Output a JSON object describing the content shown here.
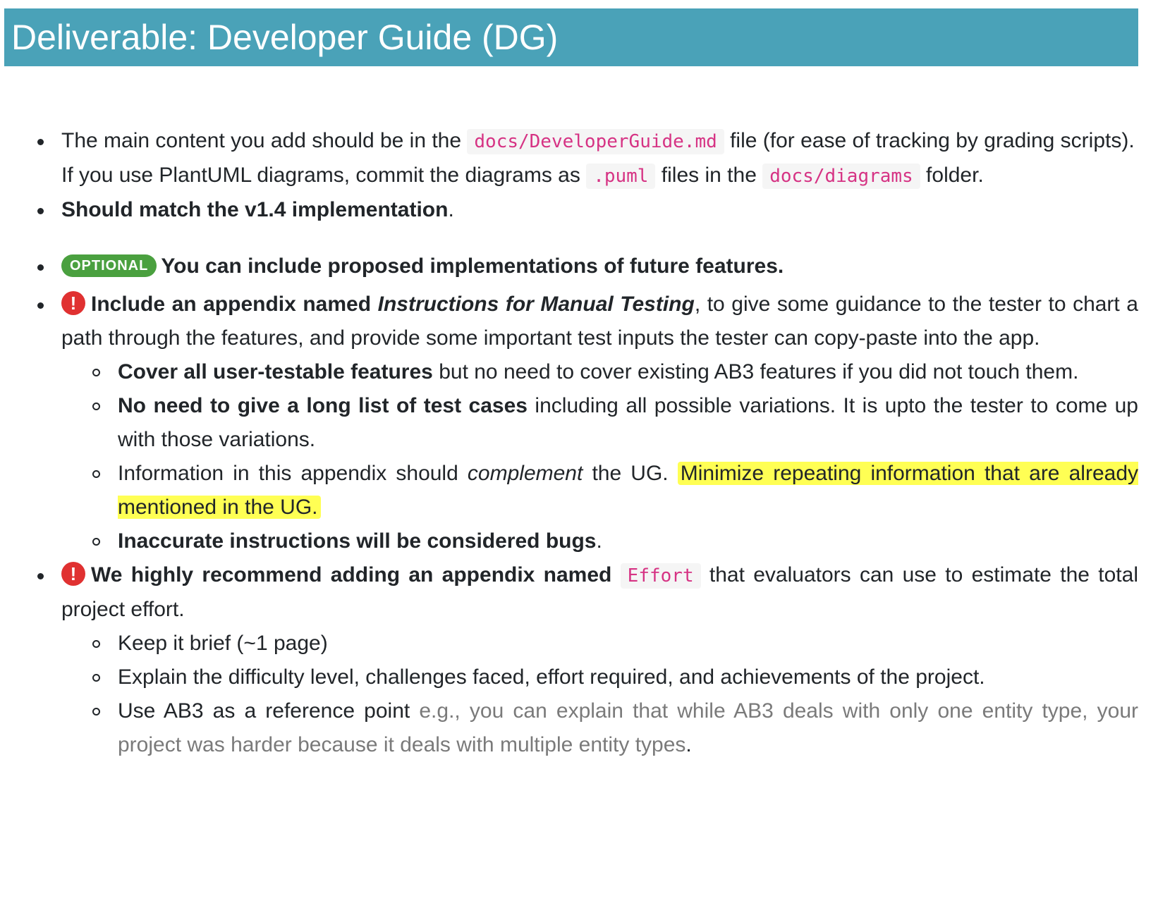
{
  "header": {
    "title": "Deliverable: Developer Guide (DG)"
  },
  "items": {
    "i1": {
      "t1": "The main content you add should be in the ",
      "code1": "docs/DeveloperGuide.md",
      "t2": " file (for ease of tracking by grading scripts).",
      "t3": "If you use PlantUML diagrams, commit the diagrams as ",
      "code2": ".puml",
      "t4": " files in the ",
      "code3": "docs/diagrams",
      "t5": " folder."
    },
    "i2": {
      "bold": "Should match the v1.4 implementation",
      "t": "."
    },
    "i3": {
      "badge": "OPTIONAL",
      "bold": "You can include proposed implementations of future features."
    },
    "i4": {
      "icon": "!",
      "bold1": "Include an appendix named ",
      "italic": "Instructions for Manual Testing",
      "t": ", to give some guidance to the tester to chart a path through the features, and provide some important test inputs the tester can copy-paste into the app.",
      "sub": {
        "s1": {
          "bold": "Cover all user-testable features",
          "t": " but no need to cover existing AB3 features if you did not touch them."
        },
        "s2": {
          "bold": "No need to give a long list of test cases",
          "t": " including all possible variations. It is upto the tester to come up with those variations."
        },
        "s3": {
          "t1": "Information in this appendix should ",
          "italic": "complement",
          "t2": " the UG. ",
          "highlight": "Minimize repeating information that are already mentioned in the UG."
        },
        "s4": {
          "bold": "Inaccurate instructions will be considered bugs",
          "t": "."
        }
      }
    },
    "i5": {
      "icon": "!",
      "bold": "We highly recommend adding an appendix named ",
      "code": "Effort",
      "t": " that evaluators can use to estimate the total project effort.",
      "sub": {
        "s1": {
          "t": "Keep it brief (~1 page)"
        },
        "s2": {
          "t": "Explain the difficulty level, challenges faced, effort required, and achievements of the project."
        },
        "s3": {
          "t1": "Use AB3 as a reference point ",
          "grey": "e.g., you can explain that while AB3 deals with only one entity type, your project was harder because it deals with multiple entity types",
          "t2": "."
        }
      }
    }
  },
  "colors": {
    "header_bg": "#4aa2b8",
    "code_text": "#d63384",
    "badge_bg": "#4aa03f",
    "warn_icon": "#e03131",
    "highlight": "#ffff54"
  }
}
